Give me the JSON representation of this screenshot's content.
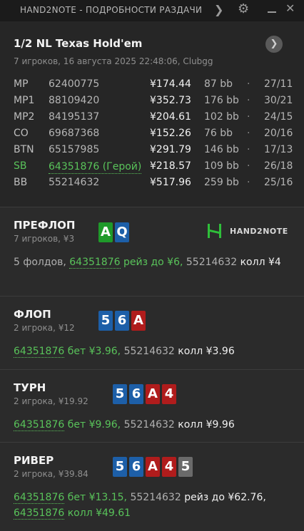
{
  "window": {
    "title": "HAND2NOTE - ПОДРОБНОСТИ РАЗДАЧИ",
    "icons": [
      "forward-arrow-icon",
      "gear-icon",
      "minimize-icon",
      "close-icon"
    ]
  },
  "header": {
    "game": "1/2 NL Texas Hold'em",
    "subtitle": "7 игроков, 16 августа 2025 22:48:06, Clubgg",
    "nav_icon": "chevron-right-icon",
    "players": [
      {
        "pos": "MP",
        "id": "62400775",
        "stack": "¥174.44",
        "bb": "87 bb",
        "dot": "·",
        "ratio": "27/11",
        "hero": false
      },
      {
        "pos": "MP1",
        "id": "88109420",
        "stack": "¥352.73",
        "bb": "176 bb",
        "dot": "·",
        "ratio": "30/21",
        "hero": false
      },
      {
        "pos": "MP2",
        "id": "84195137",
        "stack": "¥204.61",
        "bb": "102 bb",
        "dot": "·",
        "ratio": "24/15",
        "hero": false
      },
      {
        "pos": "CO",
        "id": "69687368",
        "stack": "¥152.26",
        "bb": "76 bb",
        "dot": "·",
        "ratio": "20/16",
        "hero": false
      },
      {
        "pos": "BTN",
        "id": "65157985",
        "stack": "¥291.79",
        "bb": "146 bb",
        "dot": "·",
        "ratio": "17/13",
        "hero": false
      },
      {
        "pos": "SB",
        "id": "64351876 (Герой)",
        "stack": "¥218.57",
        "bb": "109 bb",
        "dot": "·",
        "ratio": "26/18",
        "hero": true
      },
      {
        "pos": "BB",
        "id": "55214632",
        "stack": "¥517.96",
        "bb": "259 bb",
        "dot": "·",
        "ratio": "25/16",
        "hero": false
      }
    ]
  },
  "brand": {
    "logo_text": "HAND2NOTE",
    "logo_color": "#2fbf3a"
  },
  "suit_colors": {
    "clubs": "#1f9a2a",
    "diamonds": "#1d5fa8",
    "hearts": "#b01c1c",
    "spades": "#6a6a6a"
  },
  "streets": {
    "preflop": {
      "name": "ПРЕФЛОП",
      "sub": "7 игроков, ¥3",
      "cards": [
        {
          "rank": "A",
          "suit": "clubs"
        },
        {
          "rank": "Q",
          "suit": "diamonds"
        }
      ],
      "action": {
        "a1": "5 фолдов,",
        "a2": "64351876",
        "a3": "рейз до ¥6,",
        "a4": "55214632",
        "a5": "колл ¥4"
      }
    },
    "flop": {
      "name": "ФЛОП",
      "sub": "2 игрока, ¥12",
      "cards": [
        {
          "rank": "5",
          "suit": "diamonds"
        },
        {
          "rank": "6",
          "suit": "diamonds"
        },
        {
          "rank": "A",
          "suit": "hearts"
        }
      ],
      "action": {
        "a1": "64351876",
        "a2": "бет ¥3.96,",
        "a3": "55214632",
        "a4": "колл ¥3.96"
      }
    },
    "turn": {
      "name": "ТУРН",
      "sub": "2 игрока, ¥19.92",
      "cards": [
        {
          "rank": "5",
          "suit": "diamonds"
        },
        {
          "rank": "6",
          "suit": "diamonds"
        },
        {
          "rank": "A",
          "suit": "hearts"
        },
        {
          "rank": "4",
          "suit": "hearts"
        }
      ],
      "action": {
        "a1": "64351876",
        "a2": "бет ¥9.96,",
        "a3": "55214632",
        "a4": "колл ¥9.96"
      }
    },
    "river": {
      "name": "РИВЕР",
      "sub": "2 игрока, ¥39.84",
      "cards": [
        {
          "rank": "5",
          "suit": "diamonds"
        },
        {
          "rank": "6",
          "suit": "diamonds"
        },
        {
          "rank": "A",
          "suit": "hearts"
        },
        {
          "rank": "4",
          "suit": "hearts"
        },
        {
          "rank": "5",
          "suit": "spades"
        }
      ],
      "action": {
        "a1": "64351876",
        "a2": "бет ¥13.15,",
        "a3": "55214632",
        "a4": "рейз до ¥62.76,",
        "a5": "64351876",
        "a6": "колл ¥49.61"
      }
    }
  }
}
